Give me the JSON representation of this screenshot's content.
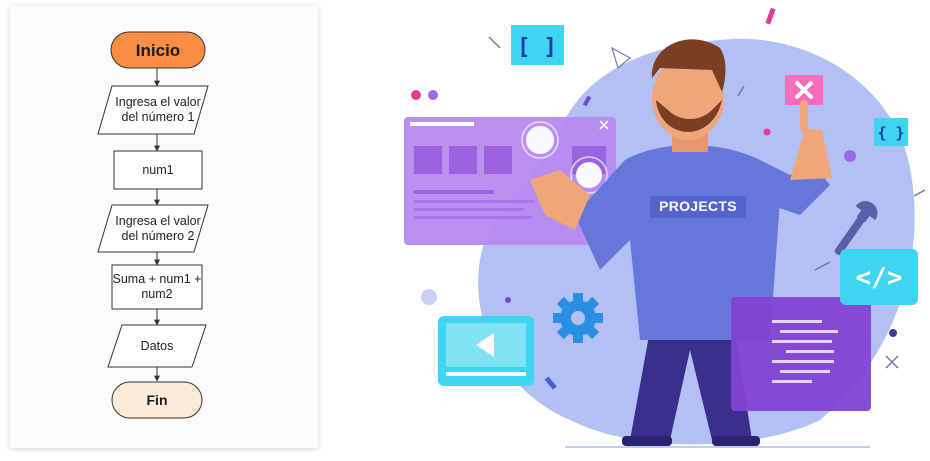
{
  "flowchart": {
    "nodes": [
      {
        "id": "start",
        "shape": "terminator",
        "label": "Inicio",
        "fill": "#fb8c44"
      },
      {
        "id": "input1",
        "shape": "parallelogram",
        "label": "Ingresa el valor del número 1"
      },
      {
        "id": "var1",
        "shape": "process",
        "label": "num1"
      },
      {
        "id": "input2",
        "shape": "parallelogram",
        "label": "Ingresa el valor del número 2"
      },
      {
        "id": "sum",
        "shape": "process",
        "label": "Suma + num1 + num2"
      },
      {
        "id": "output",
        "shape": "parallelogram",
        "label": "Datos"
      },
      {
        "id": "end",
        "shape": "terminator",
        "label": "Fin",
        "fill": "#fcebd9"
      }
    ],
    "edges": [
      [
        "start",
        "input1"
      ],
      [
        "input1",
        "var1"
      ],
      [
        "var1",
        "input2"
      ],
      [
        "input2",
        "sum"
      ],
      [
        "sum",
        "output"
      ],
      [
        "output",
        "end"
      ]
    ]
  },
  "illustration": {
    "shirt_text": "PROJECTS",
    "code_tag": "</>",
    "bracket_tag": "[ ]",
    "small_bracket_tag": "{ }",
    "colors": {
      "blob": "#b3c0f3",
      "purple_panel": "#b78af0",
      "dark_panel": "#8243d3",
      "cyan": "#3fd4f0",
      "pink": "#f76cbc"
    }
  }
}
